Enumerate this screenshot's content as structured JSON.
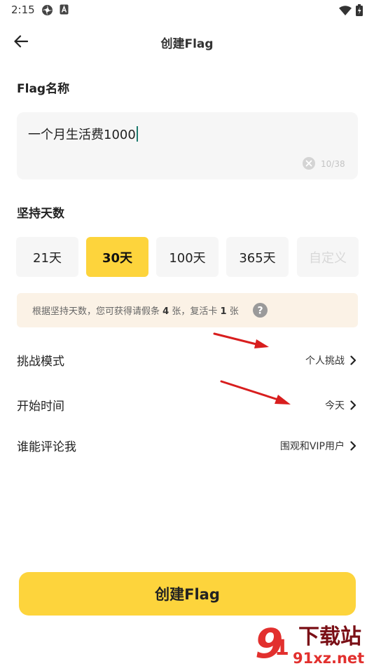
{
  "status_bar": {
    "time": "2:15"
  },
  "header": {
    "title": "创建Flag"
  },
  "flag_name": {
    "label": "Flag名称",
    "value": "一个月生活费1000",
    "counter": "10/38"
  },
  "duration": {
    "label": "坚持天数",
    "options": [
      {
        "label": "21天",
        "state": "normal"
      },
      {
        "label": "30天",
        "state": "selected"
      },
      {
        "label": "100天",
        "state": "normal"
      },
      {
        "label": "365天",
        "state": "normal"
      },
      {
        "label": "自定义",
        "state": "disabled"
      }
    ]
  },
  "info": {
    "prefix": "根据坚持天数，您可获得请假条",
    "leave_count": "4",
    "middle": "张，复活卡",
    "revive_count": "1",
    "suffix": "张"
  },
  "settings": [
    {
      "label": "挑战模式",
      "value": "个人挑战"
    },
    {
      "label": "开始时间",
      "value": "今天"
    },
    {
      "label": "谁能评论我",
      "value": "围观和VIP用户"
    }
  ],
  "create_button": {
    "label": "创建Flag"
  },
  "watermark": {
    "brand": "下载站",
    "domain": "91xz.net"
  },
  "colors": {
    "accent_yellow": "#fdd43c",
    "input_bg": "#f6f6f6",
    "banner_bg": "#fbf2e6",
    "annotation_red": "#d81e1e"
  }
}
